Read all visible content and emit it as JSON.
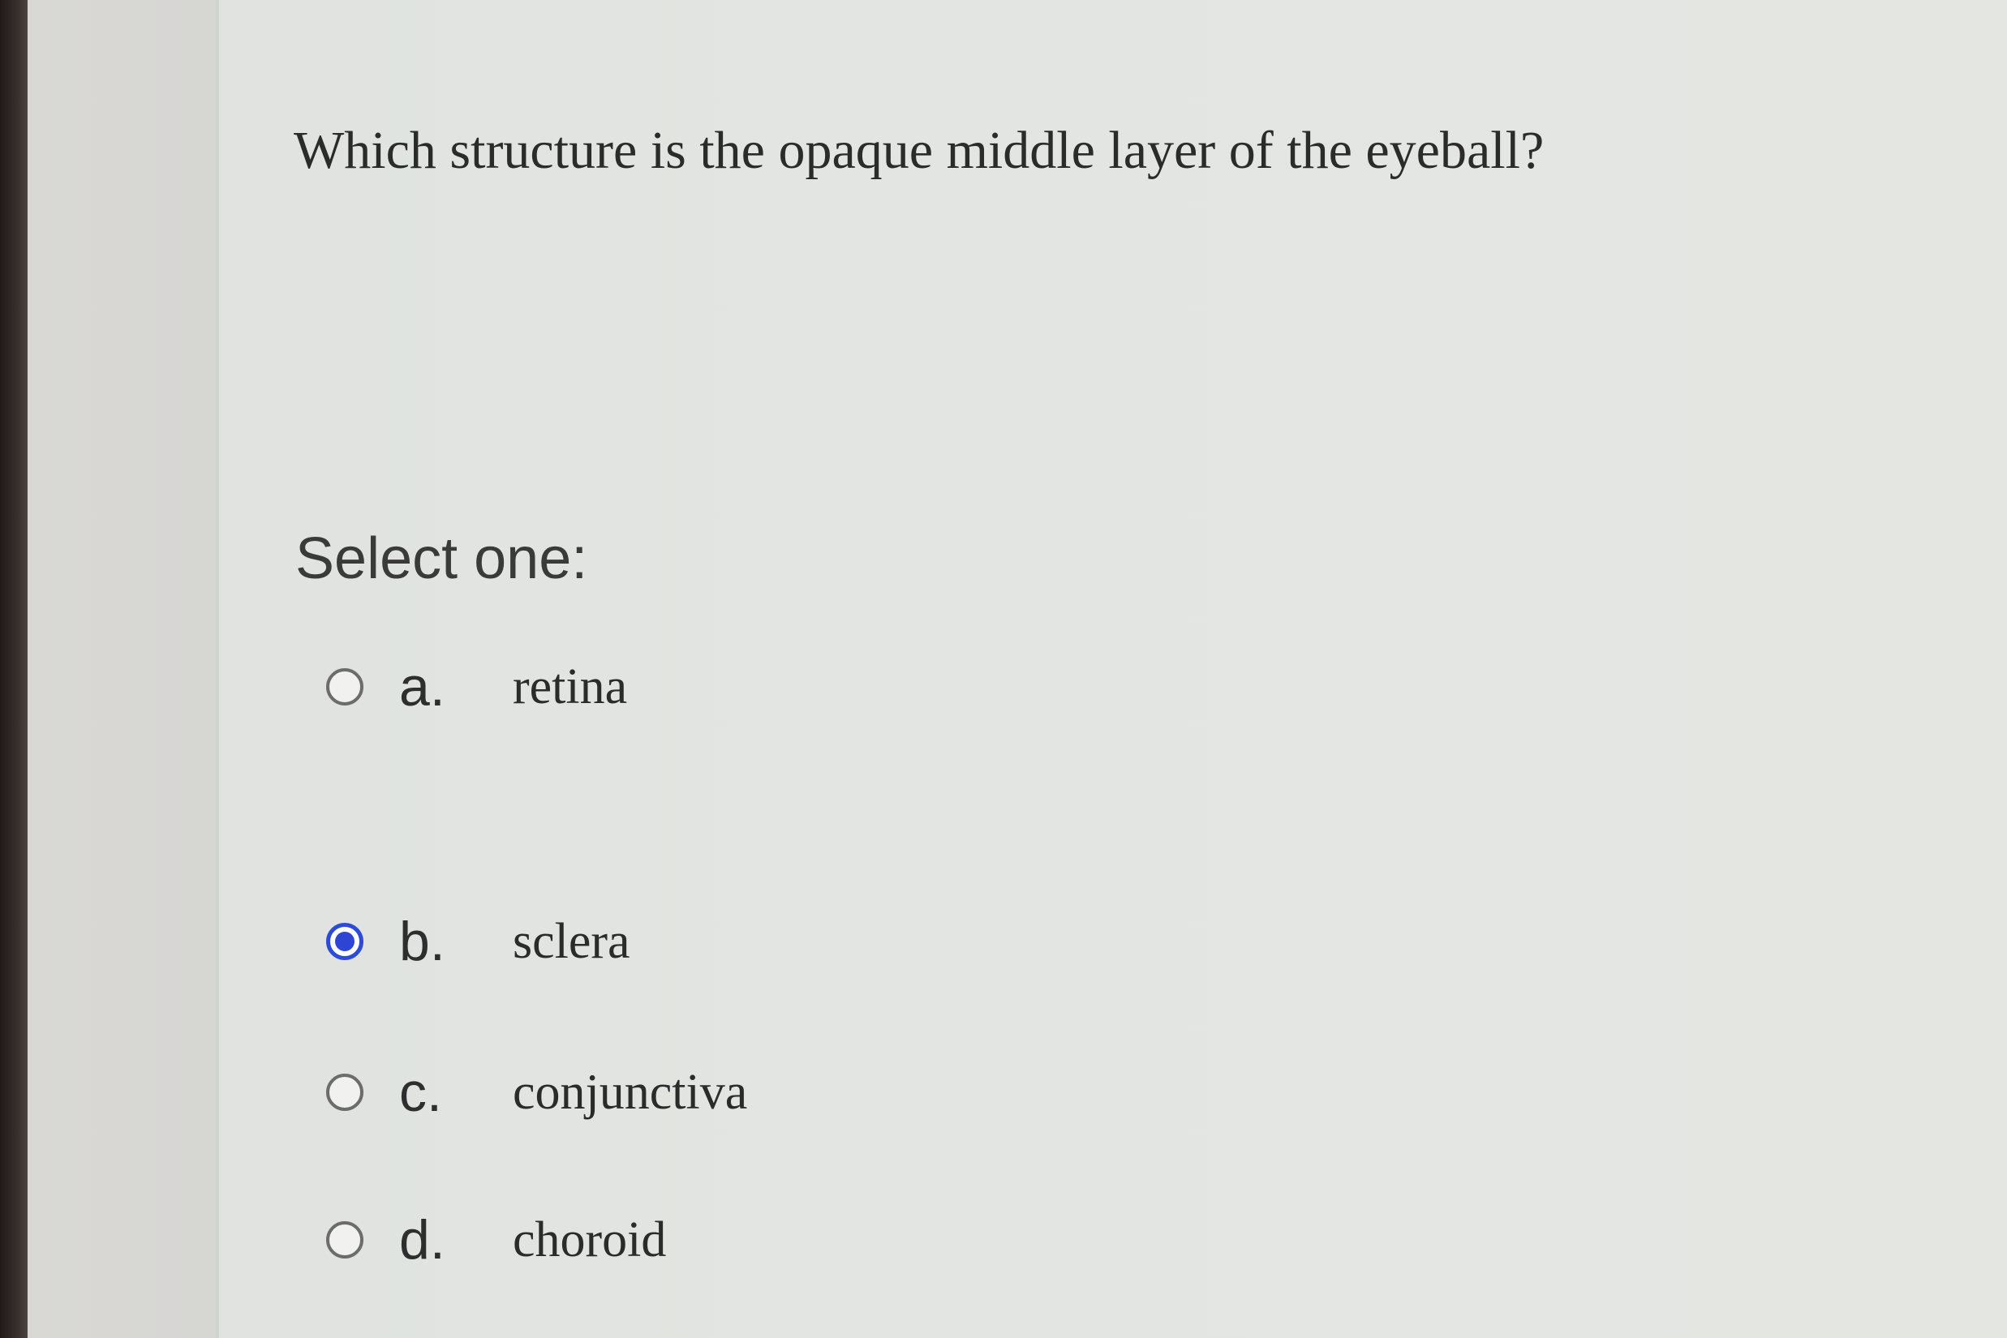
{
  "question": {
    "text": "Which structure is the opaque middle layer of the eyeball?"
  },
  "answer": {
    "prompt": "Select one:",
    "options": [
      {
        "letter": "a.",
        "text": "retina",
        "selected": false
      },
      {
        "letter": "b.",
        "text": "sclera",
        "selected": true
      },
      {
        "letter": "c.",
        "text": "conjunctiva",
        "selected": false
      },
      {
        "letter": "d.",
        "text": "choroid",
        "selected": false
      }
    ]
  },
  "colors": {
    "radio_selected": "#2d44d4",
    "background": "#e2e5e1"
  }
}
